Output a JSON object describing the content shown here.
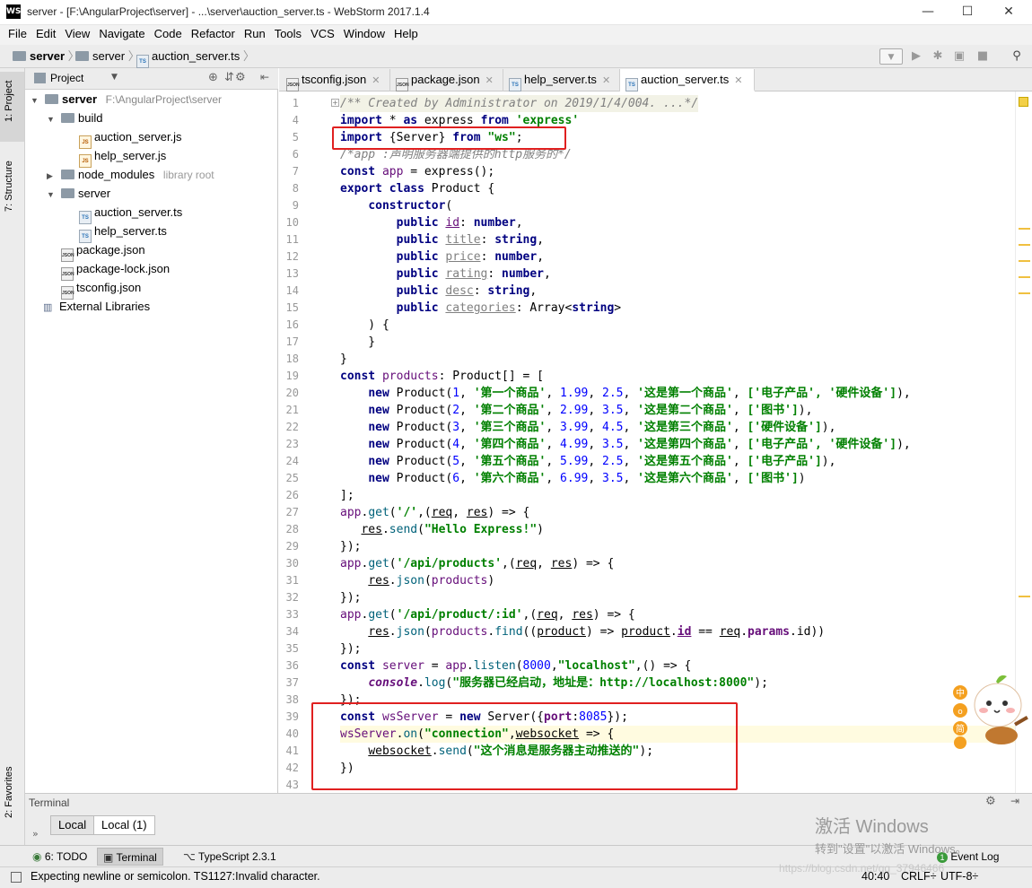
{
  "window": {
    "title": "server - [F:\\AngularProject\\server] - ...\\server\\auction_server.ts - WebStorm 2017.1.4",
    "app_icon": "WS",
    "minimize": "—",
    "maximize": "☐",
    "close": "✕"
  },
  "menu": [
    "File",
    "Edit",
    "View",
    "Navigate",
    "Code",
    "Refactor",
    "Run",
    "Tools",
    "VCS",
    "Window",
    "Help"
  ],
  "breadcrumb": {
    "root": "server",
    "folder": "server",
    "file": "auction_server.ts"
  },
  "project_panel": {
    "header": "Project",
    "tree": [
      {
        "label": "server",
        "hint": "F:\\AngularProject\\server",
        "type": "folder",
        "depth": 0,
        "expanded": true
      },
      {
        "label": "build",
        "type": "folder",
        "depth": 1,
        "expanded": true
      },
      {
        "label": "auction_server.js",
        "type": "js",
        "depth": 2
      },
      {
        "label": "help_server.js",
        "type": "js",
        "depth": 2
      },
      {
        "label": "node_modules",
        "hint": "library root",
        "type": "folder",
        "depth": 1,
        "expanded": false
      },
      {
        "label": "server",
        "type": "folder",
        "depth": 1,
        "expanded": true
      },
      {
        "label": "auction_server.ts",
        "type": "ts",
        "depth": 2
      },
      {
        "label": "help_server.ts",
        "type": "ts",
        "depth": 2
      },
      {
        "label": "package.json",
        "type": "json",
        "depth": 1
      },
      {
        "label": "package-lock.json",
        "type": "json",
        "depth": 1
      },
      {
        "label": "tsconfig.json",
        "type": "json",
        "depth": 1
      },
      {
        "label": "External Libraries",
        "type": "lib",
        "depth": 0
      }
    ]
  },
  "left_strip": {
    "project": "1: Project",
    "structure": "7: Structure",
    "favorites": "2: Favorites"
  },
  "tabs": [
    {
      "label": "tsconfig.json",
      "icon": "JSON",
      "active": false
    },
    {
      "label": "package.json",
      "icon": "JSON",
      "active": false
    },
    {
      "label": "help_server.ts",
      "icon": "TS",
      "active": false
    },
    {
      "label": "auction_server.ts",
      "icon": "TS",
      "active": true
    }
  ],
  "editor": {
    "line_numbers": [
      "1",
      "4",
      "5",
      "6",
      "7",
      "8",
      "9",
      "10",
      "11",
      "12",
      "13",
      "14",
      "15",
      "16",
      "17",
      "18",
      "19",
      "20",
      "21",
      "22",
      "23",
      "24",
      "25",
      "26",
      "27",
      "28",
      "29",
      "30",
      "31",
      "32",
      "33",
      "34",
      "35",
      "36",
      "37",
      "38",
      "39",
      "40",
      "41",
      "42",
      "43"
    ],
    "folded_comment": "/** Created by Administrator on 2019/1/4/004. ...*/",
    "import1_path": "'express'",
    "import2_path": "\"ws\"",
    "comment_app": "/*app :声明服务器端提供的http服务的*/",
    "products": [
      {
        "id": "1",
        "title": "'第一个商品'",
        "price": "1.99",
        "rating": "2.5",
        "desc": "'这是第一个商品'",
        "cats": "['电子产品', '硬件设备']"
      },
      {
        "id": "2",
        "title": "'第二个商品'",
        "price": "2.99",
        "rating": "3.5",
        "desc": "'这是第二个商品'",
        "cats": "['图书']"
      },
      {
        "id": "3",
        "title": "'第三个商品'",
        "price": "3.99",
        "rating": "4.5",
        "desc": "'这是第三个商品'",
        "cats": "['硬件设备']"
      },
      {
        "id": "4",
        "title": "'第四个商品'",
        "price": "4.99",
        "rating": "3.5",
        "desc": "'这是第四个商品'",
        "cats": "['电子产品', '硬件设备']"
      },
      {
        "id": "5",
        "title": "'第五个商品'",
        "price": "5.99",
        "rating": "2.5",
        "desc": "'这是第五个商品'",
        "cats": "['电子产品']"
      },
      {
        "id": "6",
        "title": "'第六个商品'",
        "price": "6.99",
        "rating": "3.5",
        "desc": "'这是第六个商品'",
        "cats": "['图书']"
      }
    ],
    "route_root": "'/'",
    "hello": "\"Hello Express!\"",
    "route_products": "'/api/products'",
    "route_product": "'/api/product/:id'",
    "port": "8000",
    "host": "\"localhost\"",
    "log_msg": "\"服务器已经启动，地址是：http://localhost:8000\"",
    "ws_port": "8085",
    "ws_event": "\"connection\"",
    "ws_msg": "\"这个消息是服务器主动推送的\""
  },
  "terminal": {
    "title": "Terminal",
    "tab_local": "Local",
    "tab_local1": "Local (1)"
  },
  "toolwindows": [
    {
      "label": "6: TODO",
      "icon": "todo-icon"
    },
    {
      "label": "Terminal",
      "icon": "terminal-icon"
    },
    {
      "label": "TypeScript 2.3.1",
      "icon": "typescript-icon"
    }
  ],
  "event_log": {
    "count": "1",
    "label": "Event Log"
  },
  "status": {
    "message": "Expecting newline or semicolon. TS1127:Invalid character.",
    "position": "40:40",
    "line_sep": "CRLF÷",
    "encoding": "UTF-8÷"
  },
  "watermark": {
    "line1": "激活 Windows",
    "line2": "转到\"设置\"以激活 Windows。"
  },
  "csdn_url": "https://blog.csdn.net/qq_37946466"
}
